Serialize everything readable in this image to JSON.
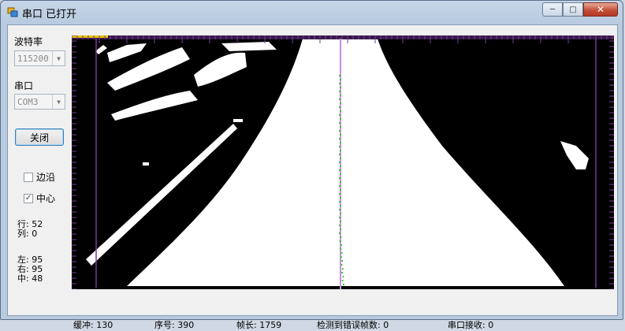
{
  "window": {
    "title": "串口 已打开",
    "minimize_icon": "minimize-icon",
    "maximize_icon": "maximize-icon",
    "close_icon": "close-icon"
  },
  "left_panel": {
    "baud_label": "波特率",
    "baud_value": "115200",
    "port_label": "串口",
    "port_value": "COM3",
    "close_button": "关闭",
    "edge_checkbox": {
      "label": "边沿",
      "checked": false
    },
    "center_checkbox": {
      "label": "中心",
      "checked": true
    },
    "row_label": "行:",
    "row_value": "52",
    "col_label": "列:",
    "col_value": "0",
    "left_label": "左:",
    "left_value": "95",
    "right_label": "右:",
    "right_value": "95",
    "mid_label": "中:",
    "mid_value": "48"
  },
  "status_bar": {
    "buffer": "缓冲: 130",
    "seq": "序号: 390",
    "frame_len": "帧长: 1759",
    "err_frames": "检测到错误帧数: 0",
    "rx": "串口接收: 0"
  },
  "colors": {
    "ruler": "#7a3a9a",
    "center_line": "#c98fe0",
    "center_points": "#2ecc2e",
    "progress": "#e6c200"
  }
}
